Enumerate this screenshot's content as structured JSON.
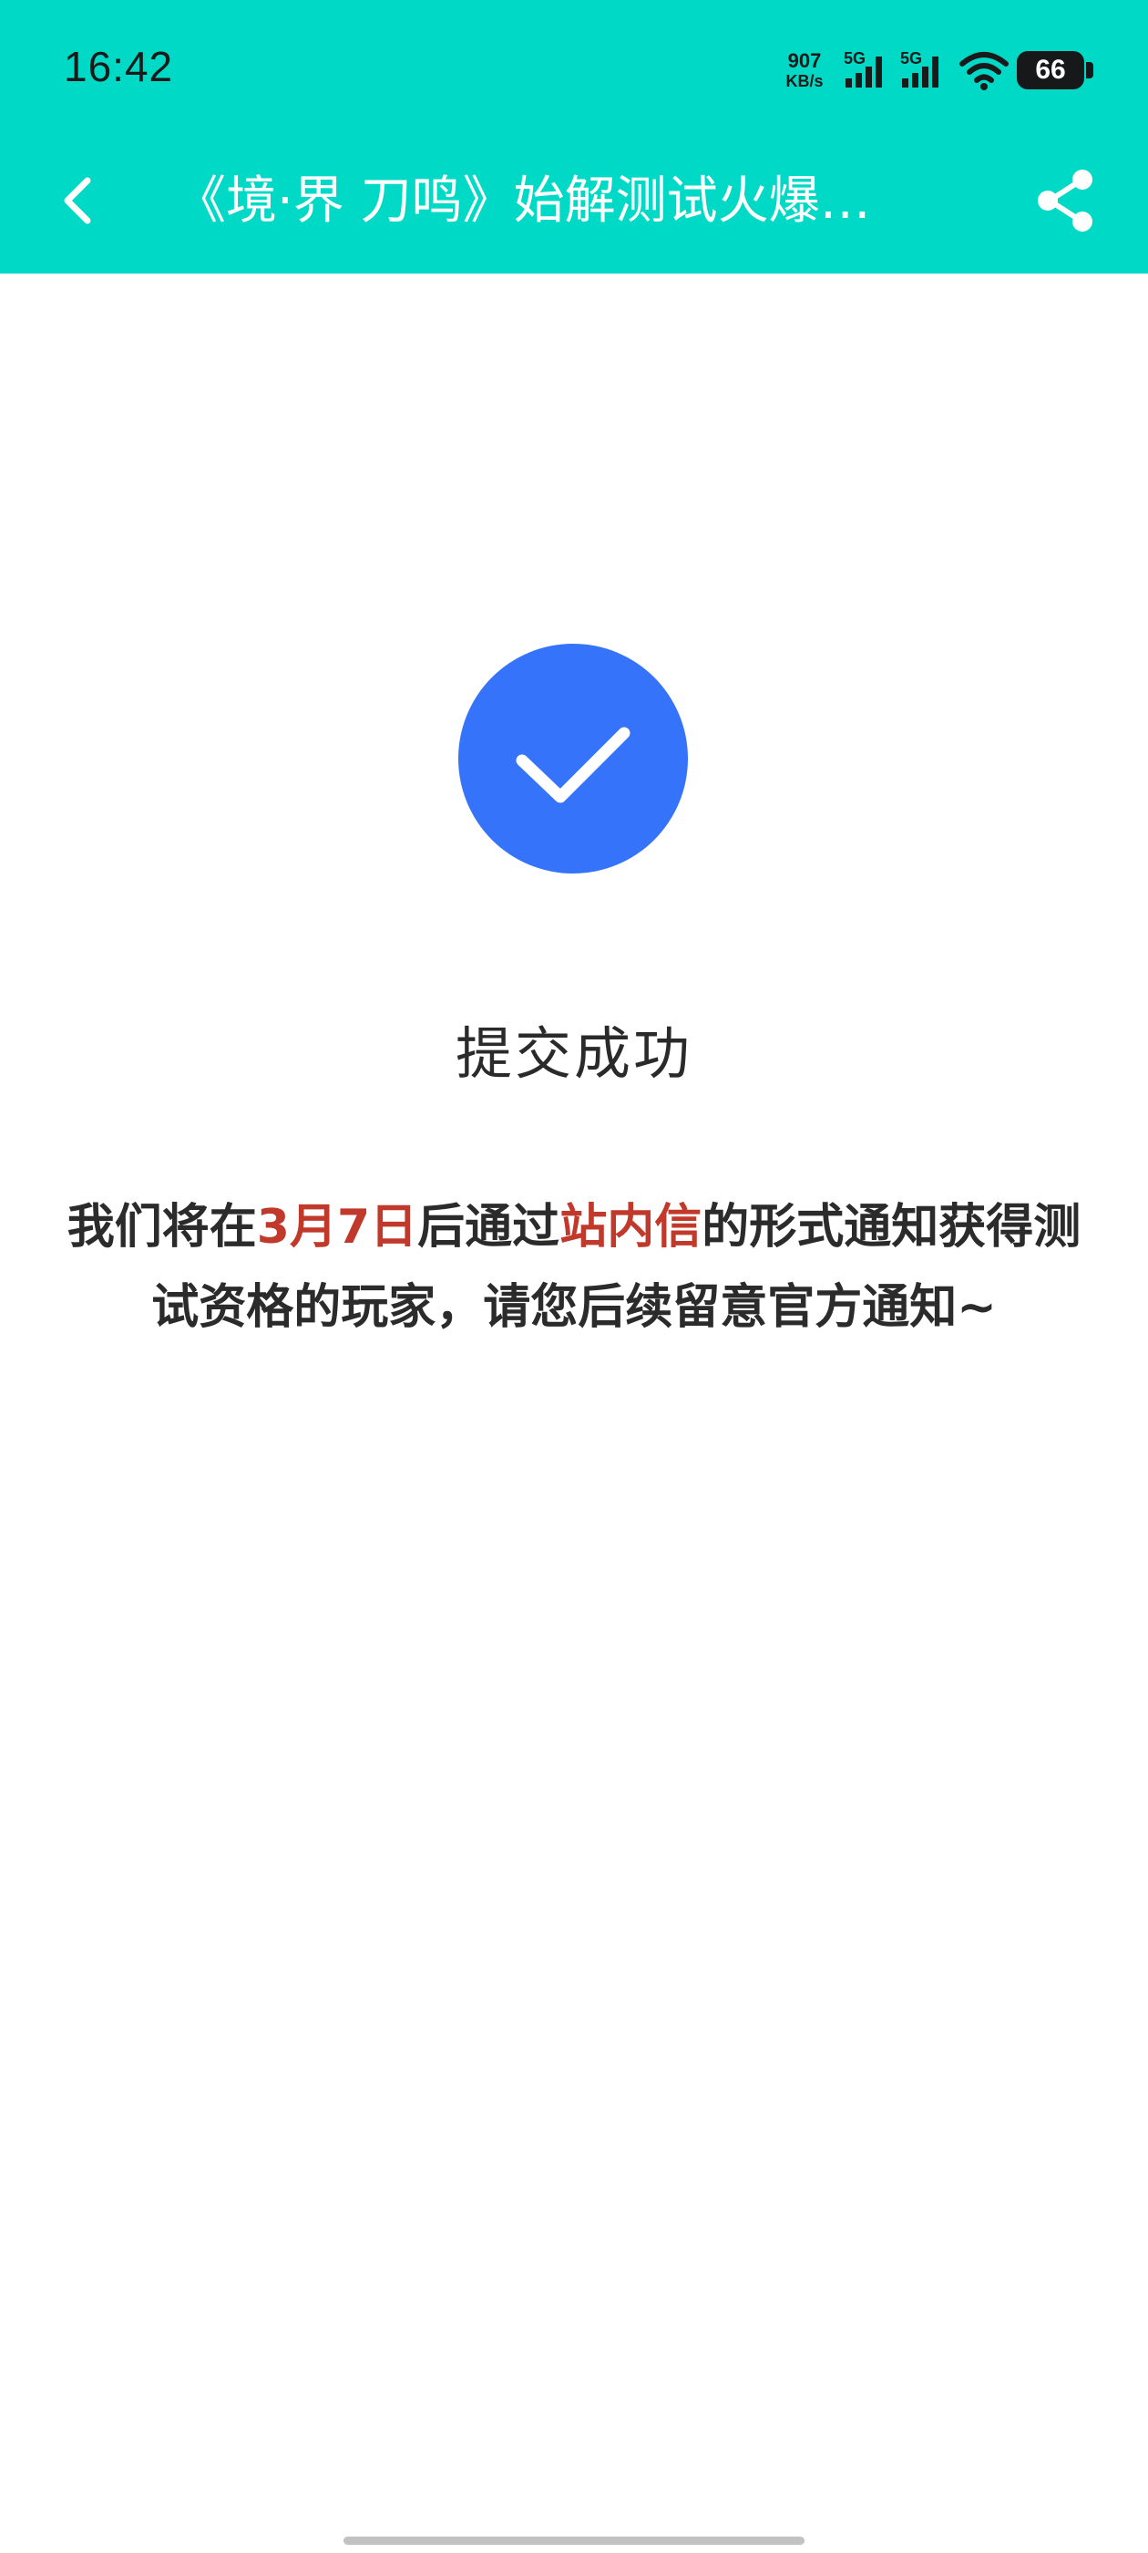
{
  "status_bar": {
    "time": "16:42",
    "net_speed_value": "907",
    "net_speed_unit": "KB/s",
    "sim1_label": "5G",
    "sim2_label": "5G",
    "battery_level": "66"
  },
  "app_bar": {
    "title": "《境·界 刀鸣》始解测试火爆…",
    "back_icon": "chevron-left-icon",
    "share_icon": "share-icon"
  },
  "result": {
    "icon": "check-circle-icon",
    "title": "提交成功",
    "message": {
      "part1": "我们将在",
      "date": "3月7日",
      "part2": "后通过",
      "channel": "站内信",
      "part3": "的形式通知获得测试资格的玩家，请您后续留意官方通知~"
    }
  },
  "colors": {
    "header_bg": "#00d9c6",
    "accent_blue": "#3573fb",
    "highlight_red": "#c0392b"
  }
}
